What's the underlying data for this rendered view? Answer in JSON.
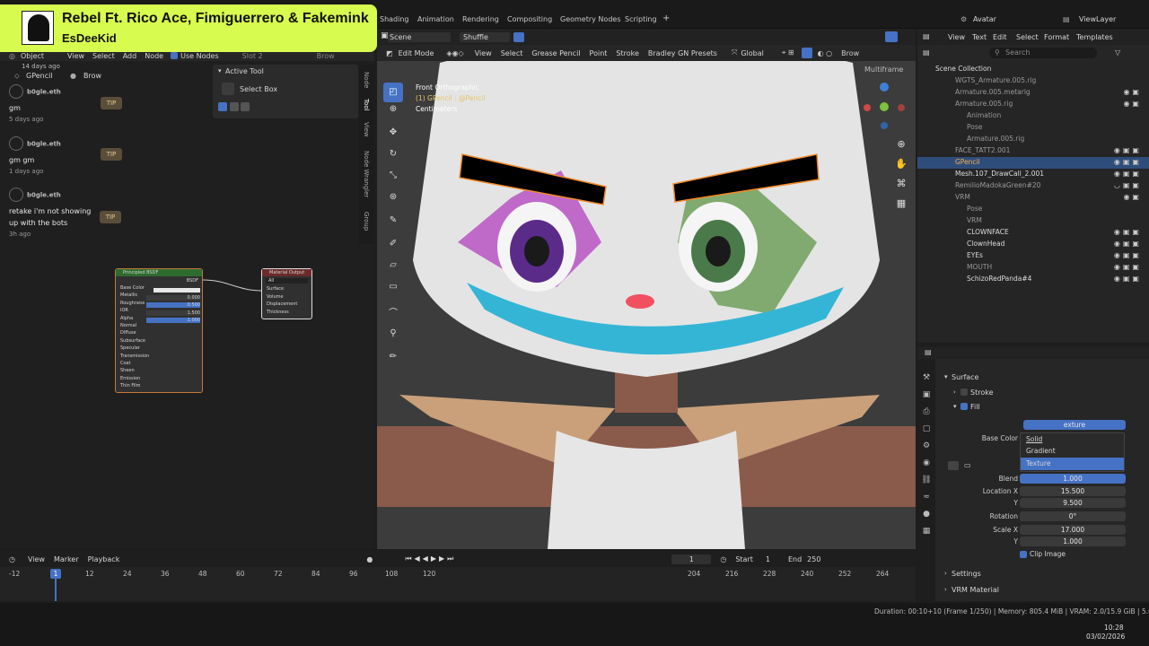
{
  "music": {
    "title": "Rebel Ft. Rico Ace, Fimiguerrero & Fakemink",
    "artist": "EsDeeKid"
  },
  "topbar": {
    "workspaces": [
      "Shading",
      "Animation",
      "Rendering",
      "Compositing",
      "Geometry Nodes",
      "Scripting"
    ],
    "add": "+",
    "scene": "Scene",
    "shuffle": "Shuffle",
    "avatar": "Avatar",
    "viewlayer": "ViewLayer"
  },
  "left_header": {
    "object": "Object",
    "menus": [
      "View",
      "Select",
      "Add",
      "Node"
    ],
    "use_nodes": "Use Nodes",
    "slot": "Slot 2",
    "browse": "Brow",
    "days_ago": "14 days ago",
    "gpencil": "GPencil",
    "brow": "Brow"
  },
  "chat": [
    {
      "name": "b0gle.eth",
      "text": "gm",
      "time": "5 days ago",
      "tip": "TIP"
    },
    {
      "name": "b0gle.eth",
      "text": "gm gm",
      "time": "1 days ago",
      "tip": "TIP"
    },
    {
      "name": "b0gle.eth",
      "text": "retake i'm not showing up with the bots",
      "time": "3h ago",
      "tip": "TIP"
    }
  ],
  "active_tool": {
    "header": "Active Tool",
    "tool": "Select Box"
  },
  "side_tabs": [
    "Node",
    "Tool",
    "View",
    "Node Wrangler",
    "Group"
  ],
  "bsdf": {
    "title": "Principled BSDF",
    "out": "BSDF",
    "rows": [
      "Base Color",
      "Metallic",
      "Roughness",
      "IOR",
      "Alpha",
      "Normal",
      "Diffuse",
      "Subsurface",
      "Specular",
      "Transmission",
      "Coat",
      "Sheen",
      "Emission",
      "Thin Film"
    ],
    "values": {
      "Metallic": "0.000",
      "Roughness": "0.500",
      "IOR": "1.500",
      "Alpha": "1.000"
    }
  },
  "matout": {
    "title": "Material Output",
    "target": "All",
    "rows": [
      "Surface",
      "Volume",
      "Displacement",
      "Thickness"
    ]
  },
  "viewport": {
    "mode": "Edit Mode",
    "menus": [
      "View",
      "Select",
      "Grease Pencil",
      "Point",
      "Stroke",
      "Bradley GN Presets"
    ],
    "orientation": "Global",
    "multiframe": "Multiframe",
    "brow": "Brow",
    "info1": "Front Orthographic",
    "info2": "(1) GPencil : @Pencil",
    "info3": "Centimeters"
  },
  "outliner": {
    "search": "Search",
    "rows": [
      {
        "label": "Scene Collection",
        "indent": 0,
        "sel": false
      },
      {
        "label": "WGTS_Armature.005.rig",
        "indent": 1,
        "sel": false
      },
      {
        "label": "Armature.005.metarig",
        "indent": 1,
        "sel": false
      },
      {
        "label": "Armature.005.rig",
        "indent": 1,
        "sel": false
      },
      {
        "label": "Animation",
        "indent": 2,
        "sel": false
      },
      {
        "label": "Pose",
        "indent": 2,
        "sel": false
      },
      {
        "label": "Armature.005.rig",
        "indent": 2,
        "sel": false
      },
      {
        "label": "FACE_TATT2.001",
        "indent": 1,
        "sel": false
      },
      {
        "label": "GPencil",
        "indent": 1,
        "sel": true
      },
      {
        "label": "Mesh.107_DrawCall_2.001",
        "indent": 1,
        "sel": false
      },
      {
        "label": "RemilioMadokaGreen#20",
        "indent": 1,
        "sel": false
      },
      {
        "label": "VRM",
        "indent": 1,
        "sel": false
      },
      {
        "label": "Pose",
        "indent": 2,
        "sel": false
      },
      {
        "label": "VRM",
        "indent": 2,
        "sel": false
      },
      {
        "label": "CLOWNFACE",
        "indent": 1,
        "sel": false
      },
      {
        "label": "ClownHead",
        "indent": 1,
        "sel": false
      },
      {
        "label": "EYEs",
        "indent": 1,
        "sel": false
      },
      {
        "label": "MOUTH",
        "indent": 1,
        "sel": false
      },
      {
        "label": "SchizoRedPanda#4",
        "indent": 1,
        "sel": false
      }
    ]
  },
  "properties": {
    "surface": "Surface",
    "stroke": "Stroke",
    "fill": "Fill",
    "texture_top": "exture",
    "base_color_label": "Base Color",
    "dropdown": [
      "Solid",
      "Gradient",
      "Texture"
    ],
    "blend_label": "Blend",
    "blend": "1.000",
    "location_label": "Location X",
    "loc_x": "15.500",
    "y_label": "Y",
    "loc_y": "9.500",
    "rotation_label": "Rotation",
    "rotation": "0°",
    "scale_label": "Scale X",
    "scale_x": "17.000",
    "scale_y": "1.000",
    "clip": "Clip Image",
    "settings": "Settings",
    "vrm_material": "VRM Material"
  },
  "timeline": {
    "menus": [
      "View",
      "Marker",
      "Playback"
    ],
    "current": "1",
    "start_label": "Start",
    "start": "1",
    "end_label": "End",
    "end": "250",
    "ticks": [
      "-12",
      "12",
      "24",
      "36",
      "48",
      "60",
      "72",
      "84",
      "96",
      "108",
      "120",
      "204",
      "216",
      "228",
      "240",
      "252",
      "264"
    ],
    "cursor": "1"
  },
  "statusbar": {
    "info": "Duration: 00:10+10 (Frame 1/250) | Memory: 805.4 MiB | VRAM: 2.0/15.9 GiB | 5.0.1",
    "time": "10:28",
    "date": "03/02/2026"
  }
}
